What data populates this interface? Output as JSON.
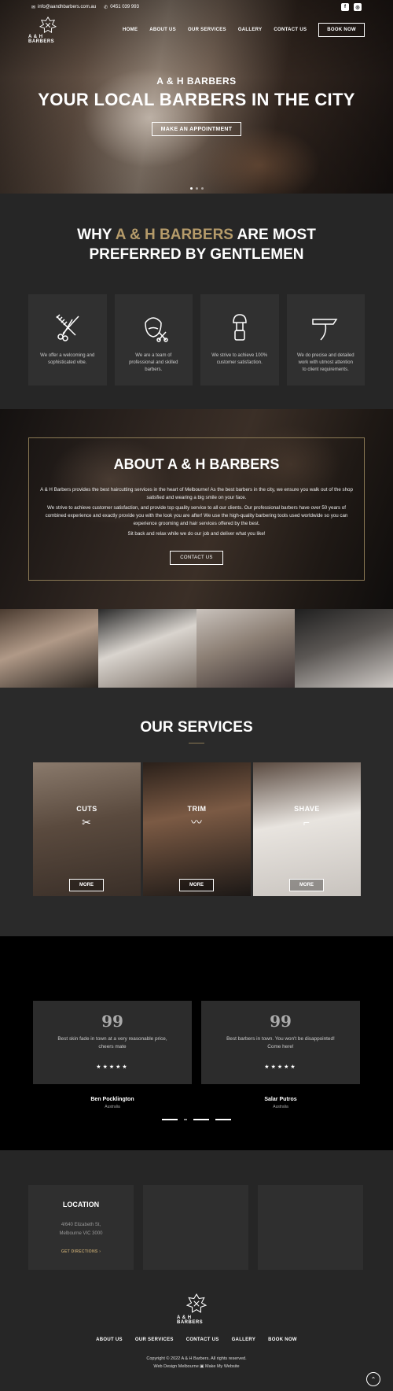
{
  "topbar": {
    "email": "info@aandhbarbers.com.au",
    "phone": "0451 039 993",
    "social": [
      "f",
      "ig"
    ]
  },
  "brand": {
    "name": "A & H BARBERS"
  },
  "nav": {
    "items": [
      "HOME",
      "ABOUT US",
      "OUR SERVICES",
      "GALLERY",
      "CONTACT US"
    ],
    "book": "BOOK NOW"
  },
  "hero": {
    "subtitle": "A & H BARBERS",
    "title": "YOUR LOCAL BARBERS IN THE CITY",
    "button": "MAKE AN APPOINTMENT"
  },
  "why": {
    "title_pre": "WHY ",
    "title_brand": "A & H BARBERS",
    "title_post": " ARE MOST PREFERRED BY GENTLEMEN",
    "cards": [
      {
        "icon": "comb-scissors-icon",
        "text": "We offer a welcoming and sophisticated vibe."
      },
      {
        "icon": "barber-face-icon",
        "text": "We are a team of professional and skilled barbers."
      },
      {
        "icon": "shaving-brush-icon",
        "text": "We strive to achieve 100% customer satisfaction."
      },
      {
        "icon": "razor-icon",
        "text": "We do precise and detailed work with utmost attention to client requirements."
      }
    ]
  },
  "about": {
    "title": "ABOUT A & H BARBERS",
    "p1": "A & H Barbers provides the best haircutting services in the heart of Melbourne! As the best barbers in the city, we ensure you walk out of the shop satisfied and wearing a big smile on your face.",
    "p2": "We strive to achieve customer satisfaction, and provide top quality service to all our clients. Our professional barbers have over 50 years of combined experience and exactly provide you with the look you are after! We use the high-quality barbering tools used worldwide so you can experience grooming and hair services offered by the best.",
    "p3": "Sit back and relax while we do our job and deliver what you like!",
    "button": "CONTACT US"
  },
  "services": {
    "title": "OUR SERVICES",
    "items": [
      {
        "label": "CUTS",
        "icon": "scissors-icon",
        "button": "MORE"
      },
      {
        "label": "TRIM",
        "icon": "moustache-icon",
        "button": "MORE"
      },
      {
        "label": "SHAVE",
        "icon": "razor-icon",
        "button": "MORE"
      }
    ]
  },
  "testimonials": [
    {
      "quote": "Best skin fade in town at a very reasonable price, cheers mate",
      "name": "Ben Pocklington",
      "country": "Australia",
      "stars": "★★★★★"
    },
    {
      "quote": "Best barbers in town. You won't be disappointed! Come here!",
      "name": "Salar Putros",
      "country": "Australia",
      "stars": "★★★★★"
    }
  ],
  "footer": {
    "location_title": "LOCATION",
    "address_line1": "4/640 Elizabeth St,",
    "address_line2": "Melbourne VIC 3000",
    "directions": "GET DIRECTIONS ›",
    "nav": [
      "ABOUT US",
      "OUR SERVICES",
      "CONTACT US",
      "GALLERY",
      "BOOK NOW"
    ],
    "copyright": "Copyright © 2022 A & H Barbers. All rights reserved.",
    "credit": "Web Design Melbourne ▣ Make My Website"
  },
  "colors": {
    "gold": "#b59b6a",
    "dark": "#262626",
    "black": "#000000"
  }
}
